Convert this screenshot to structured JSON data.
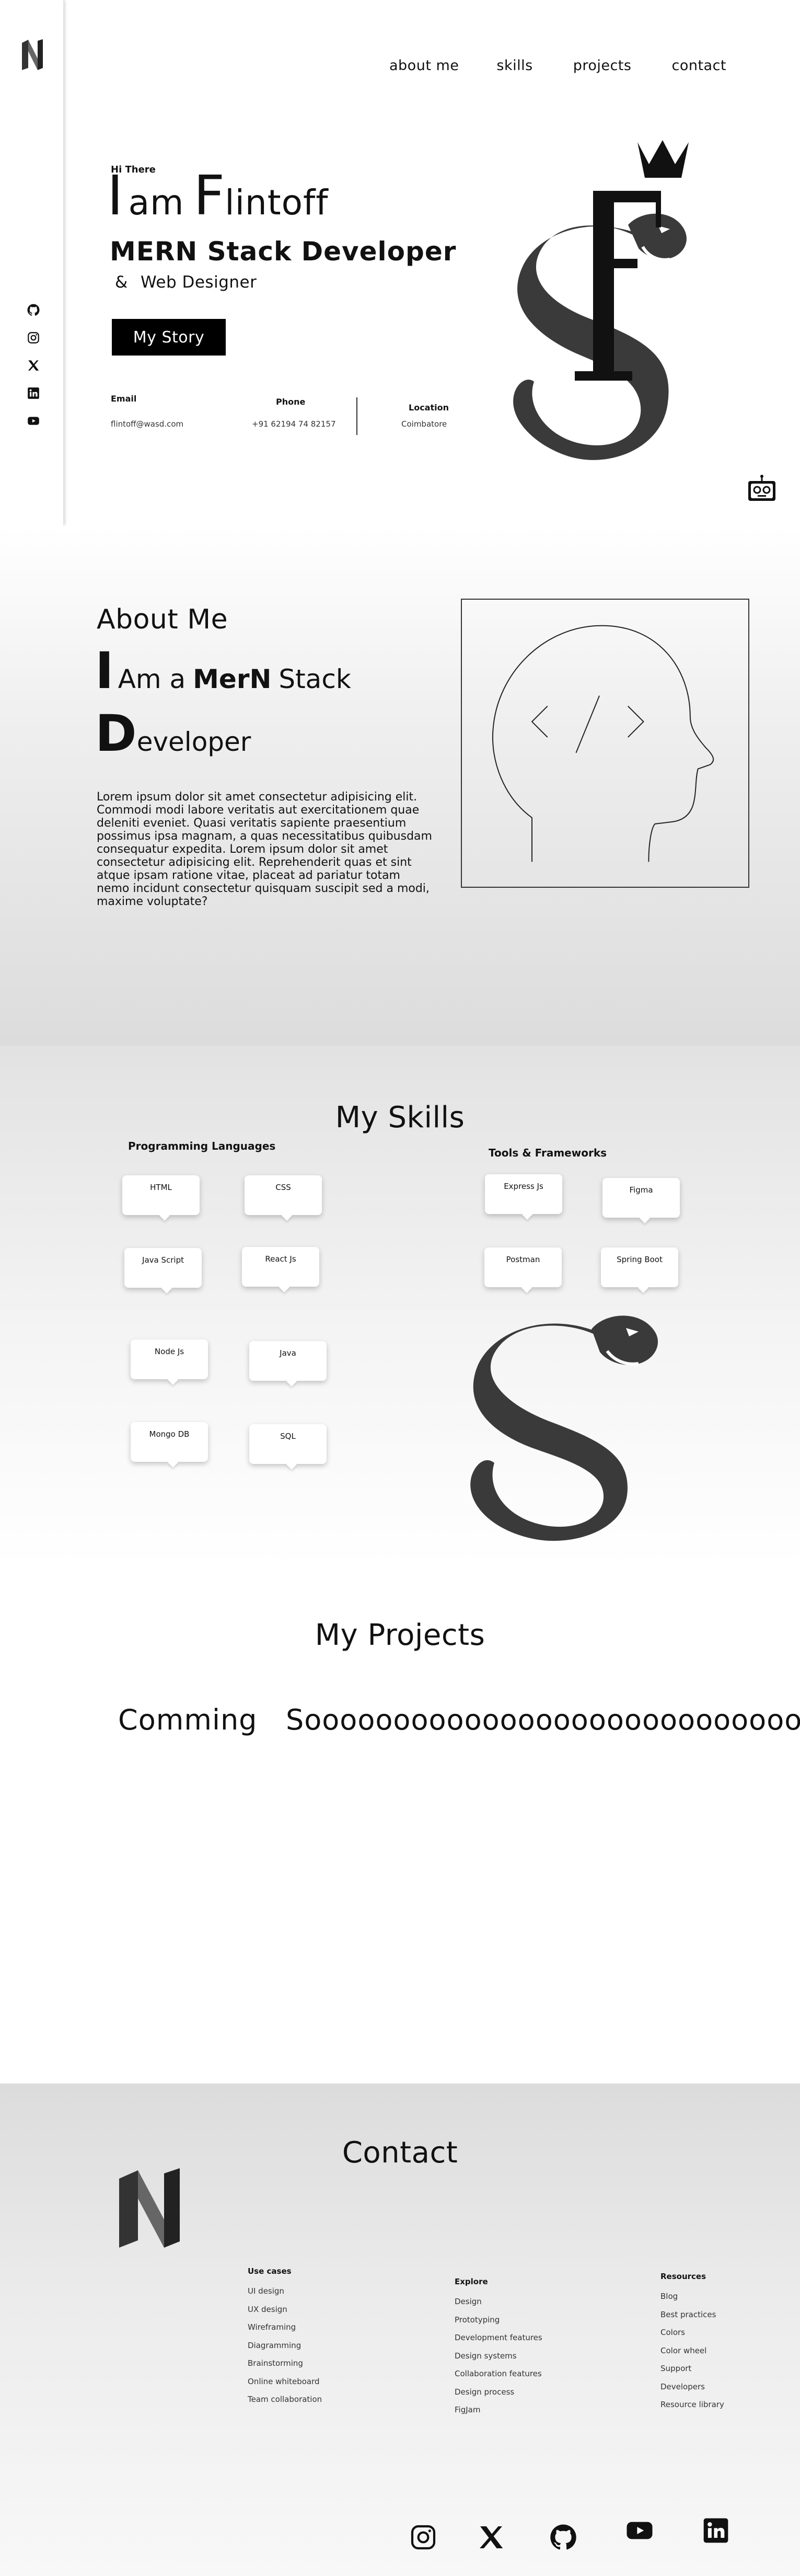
{
  "nav": {
    "items": [
      {
        "label": "about me"
      },
      {
        "label": "skills"
      },
      {
        "label": "projects"
      },
      {
        "label": "contact"
      }
    ]
  },
  "side_socials": [
    "github-icon",
    "instagram-icon",
    "x-icon",
    "linkedin-icon",
    "youtube-icon"
  ],
  "hero": {
    "greeting": "Hi There",
    "name_cap1": "I",
    "name_part1": "am",
    "name_cap2": "F",
    "name_part2": "lintoff",
    "role": "MERN Stack Developer",
    "role2_amp": "&",
    "role2": "Web Designer",
    "cta": "My Story",
    "email_label": "Email",
    "email_value": "flintoff@wasd.com",
    "phone_label": "Phone",
    "phone_value": "+91 62194 74 82157",
    "location_label": "Location",
    "location_value": "Coimbatore"
  },
  "about": {
    "title": "About Me",
    "line1_cap": "I",
    "line1_a": "Am a",
    "line1_b": "MerN",
    "line1_c": "Stack",
    "line2_cap": "D",
    "line2_rest": "eveloper",
    "body": "Lorem ipsum dolor sit amet consectetur adipisicing elit. Commodi modi labore veritatis aut exercitationem quae deleniti eveniet. Quasi veritatis sapiente praesentium possimus ipsa magnam, a quas necessitatibus quibusdam consequatur expedita. Lorem ipsum dolor sit amet consectetur adipisicing elit. Reprehenderit quas et sint atque ipsam ratione vitae, placeat ad pariatur totam nemo incidunt consectetur quisquam suscipit sed a modi, maxime voluptate?"
  },
  "skills": {
    "title": "My Skills",
    "col1_title": "Programming Languages",
    "col2_title": "Tools & Frameworks",
    "languages": [
      "HTML",
      "CSS",
      "Java Script",
      "React Js",
      "Node Js",
      "Java",
      "Mongo DB",
      "SQL"
    ],
    "tools": [
      "Express Js",
      "Figma",
      "Postman",
      "Spring Boot"
    ]
  },
  "projects": {
    "title": "My Projects",
    "coming": "Comming   Soooooooooooooooooooooooooooon"
  },
  "contact": {
    "title": "Contact",
    "columns": [
      {
        "heading": "Use cases",
        "links": [
          "UI design",
          "UX design",
          "Wireframing",
          "Diagramming",
          "Brainstorming",
          "Online whiteboard",
          "Team collaboration"
        ]
      },
      {
        "heading": "Explore",
        "links": [
          "Design",
          "Prototyping",
          "Development features",
          "Design systems",
          "Collaboration features",
          "Design process",
          "FigJam"
        ]
      },
      {
        "heading": "Resources",
        "links": [
          "Blog",
          "Best practices",
          "Colors",
          "Color wheel",
          "Support",
          "Developers",
          "Resource library"
        ]
      }
    ],
    "socials": [
      "instagram-icon",
      "x-icon",
      "github-icon",
      "youtube-icon",
      "linkedin-icon"
    ]
  }
}
